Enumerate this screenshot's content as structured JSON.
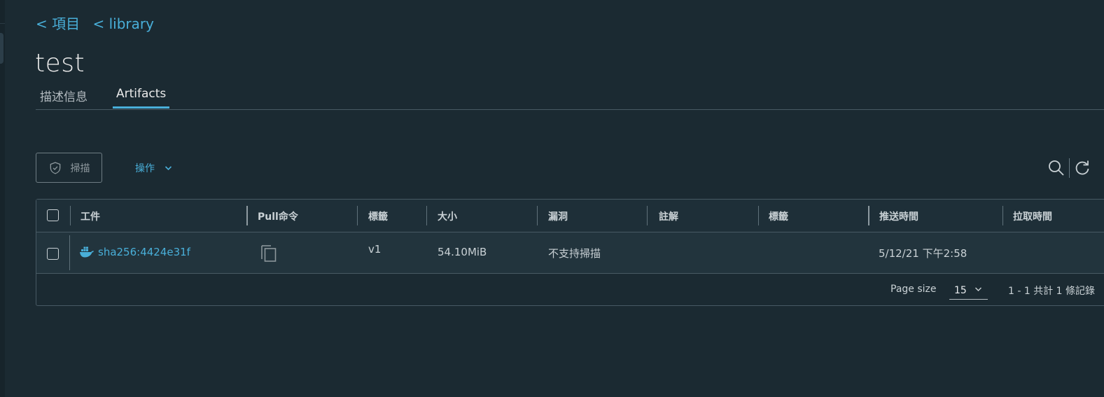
{
  "breadcrumb": {
    "projects": "< 項目",
    "library": "< library"
  },
  "page_title": "test",
  "tabs": [
    {
      "label": "描述信息",
      "active": false
    },
    {
      "label": "Artifacts",
      "active": true
    }
  ],
  "toolbar": {
    "scan_label": "掃描",
    "actions_label": "操作",
    "icons": [
      "shield-check-icon",
      "chevron-down-icon",
      "search-icon",
      "refresh-icon"
    ]
  },
  "table": {
    "columns": [
      "工件",
      "Pull命令",
      "標籤",
      "大小",
      "漏洞",
      "註解",
      "標籤",
      "推送時間",
      "拉取時間"
    ],
    "rows": [
      {
        "artifact": "sha256:4424e31f",
        "artifact_icon": "docker-whale-icon",
        "pull_icon": "copy-icon",
        "tags": "v1",
        "size": "54.10MiB",
        "vulnerabilities": "不支持掃描",
        "annotations": "",
        "labels": "",
        "push_time": "5/12/21 下午2:58",
        "pull_time": ""
      }
    ]
  },
  "footer": {
    "page_size_label": "Page size",
    "page_size_value": "15",
    "pager_text": "1 - 1 共計 1 條記錄"
  },
  "colors": {
    "background": "#1b2a32",
    "accent": "#49afd9",
    "border": "#485a64"
  }
}
